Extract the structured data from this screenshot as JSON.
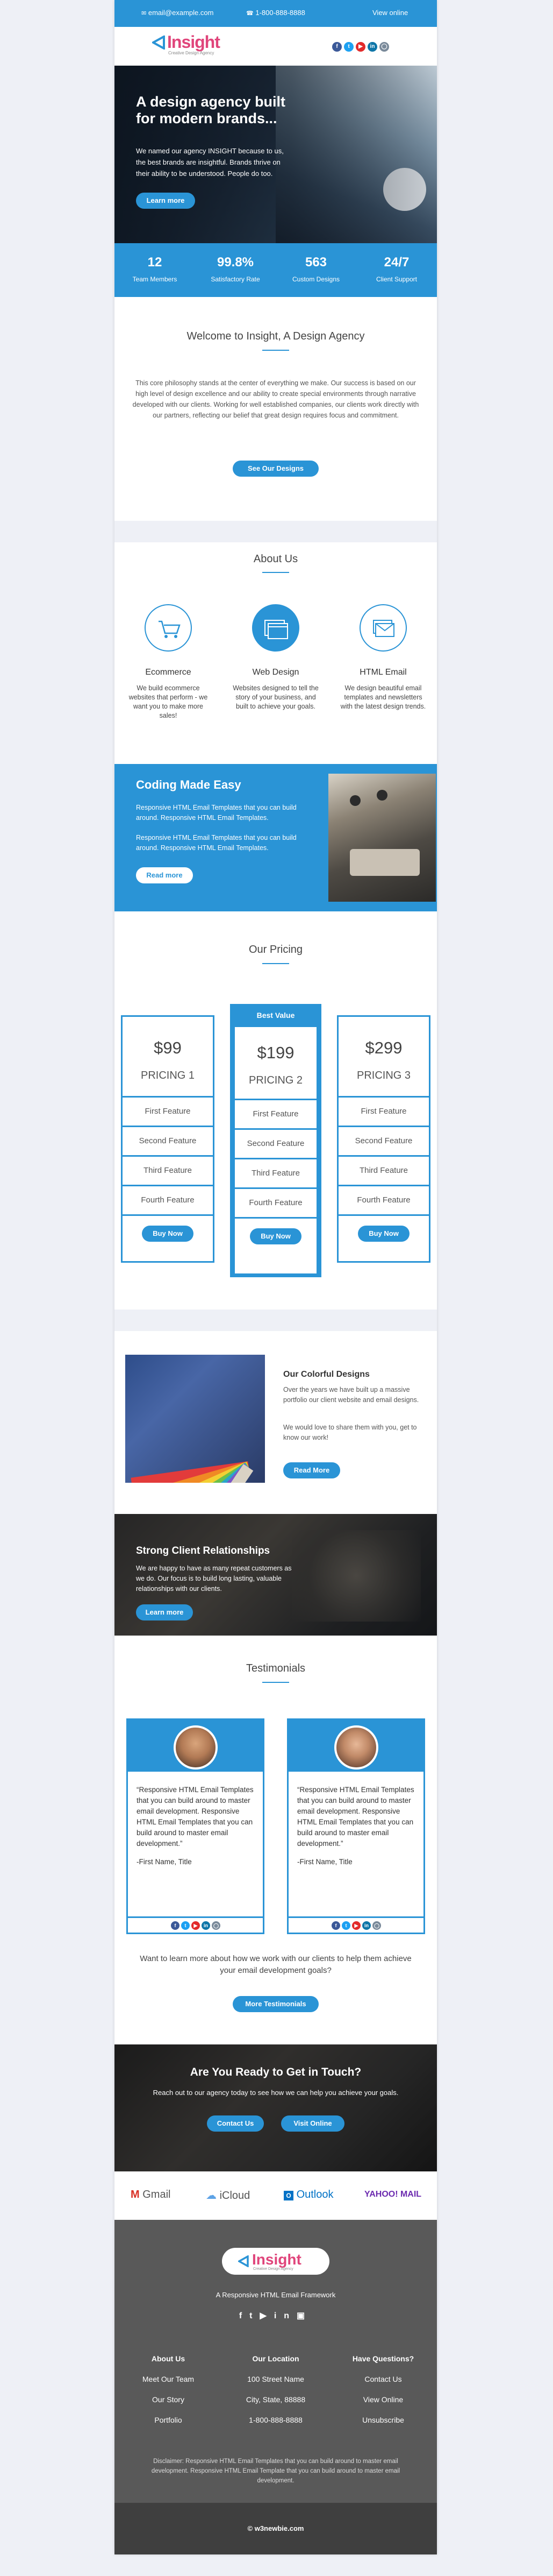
{
  "topbar": {
    "email": "email@example.com",
    "phone": "1-800-888-8888",
    "view_online": "View online"
  },
  "header": {
    "logo_text": "Insight",
    "logo_tagline": "Creative Design Agency",
    "social": [
      "f",
      "t",
      "y",
      "in",
      "ig"
    ]
  },
  "hero": {
    "title": "A design agency built for modern brands...",
    "body": "We named our agency INSIGHT because to us, the best brands are insightful. Brands thrive on their ability to be understood. People do too.",
    "cta": "Learn more"
  },
  "stats": [
    {
      "value": "12",
      "label": "Team Members"
    },
    {
      "value": "99.8%",
      "label": "Satisfactory Rate"
    },
    {
      "value": "563",
      "label": "Custom Designs"
    },
    {
      "value": "24/7",
      "label": "Client Support"
    }
  ],
  "welcome": {
    "title": "Welcome to Insight, A Design Agency",
    "body": "This core philosophy stands at the center of everything we make. Our success is based on our high level of design excellence and our ability to create special environments through narrative developed with our clients. Working for well established companies, our clients work directly with our partners, reflecting our belief that great design requires focus and commitment.",
    "cta": "See Our Designs"
  },
  "about": {
    "title": "About Us",
    "services": [
      {
        "title": "Ecommerce",
        "body": "We build ecommerce websites that perform - we want you to make more sales!"
      },
      {
        "title": "Web Design",
        "body": "Websites designed to tell the story of your business, and built to achieve your goals."
      },
      {
        "title": "HTML Email",
        "body": "We design beautiful email templates and newsletters with the latest design trends."
      }
    ]
  },
  "coding": {
    "title": "Coding Made Easy",
    "p1": "Responsive HTML Email Templates that you can build around. Responsive HTML Email Templates.",
    "p2": "Responsive HTML Email Templates that you can build around. Responsive HTML Email Templates.",
    "cta": "Read more"
  },
  "pricing": {
    "title": "Our Pricing",
    "badge": "Best Value",
    "plans": [
      {
        "price": "$99",
        "name": "PRICING 1",
        "features": [
          "First Feature",
          "Second Feature",
          "Third Feature",
          "Fourth Feature"
        ],
        "cta": "Buy Now"
      },
      {
        "price": "$199",
        "name": "PRICING 2",
        "features": [
          "First Feature",
          "Second Feature",
          "Third Feature",
          "Fourth Feature"
        ],
        "cta": "Buy Now"
      },
      {
        "price": "$299",
        "name": "PRICING 3",
        "features": [
          "First Feature",
          "Second Feature",
          "Third Feature",
          "Fourth Feature"
        ],
        "cta": "Buy Now"
      }
    ]
  },
  "designs": {
    "title": "Our Colorful Designs",
    "p1": "Over the years we have built up a massive portfolio our client website and email designs.",
    "p2": "We would love to share them with you, get to know our work!",
    "cta": "Read More"
  },
  "client": {
    "title": "Strong Client Relationships",
    "body": "We are happy to have as many repeat customers as we do. Our focus is to build long lasting, valuable relationships with our clients.",
    "cta": "Learn more"
  },
  "testimonials": {
    "title": "Testimonials",
    "items": [
      {
        "quote": "“Responsive HTML Email Templates that you can build around to master email development. Responsive HTML Email Templates that you can build around to master email development.”",
        "name": "-First Name, Title"
      },
      {
        "quote": "“Responsive HTML Email Templates that you can build around to master email development. Responsive HTML Email Templates that you can build around to master email development.”",
        "name": "-First Name, Title"
      }
    ],
    "more_text": "Want to learn more about how we work with our clients to help them achieve your email development goals?",
    "cta": "More Testimonials"
  },
  "ready": {
    "title": "Are You Ready to Get in Touch?",
    "body": "Reach out to our agency today to see how we can help you achieve your goals.",
    "contact": "Contact Us",
    "visit": "Visit Online"
  },
  "email_clients": [
    "Gmail",
    "iCloud",
    "Outlook",
    "YAHOO! MAIL"
  ],
  "footer": {
    "tagline": "A Responsive HTML Email Framework",
    "col1": [
      "About Us",
      "Meet Our Team",
      "Our Story",
      "Portfolio"
    ],
    "col2_title": "Our Location",
    "col2": [
      "100 Street Name",
      "City, State, 88888",
      "1-800-888-8888"
    ],
    "col3_title": "Have Questions?",
    "col3": [
      "Contact Us",
      "View Online",
      "Unsubscribe"
    ],
    "disclaimer": "Disclaimer: Responsive HTML Email Templates that you can build around to master email development. Responsive HTML Email Template that you can build around to master email development.",
    "copyright": "© w3newbie.com"
  },
  "colors": {
    "accent": "#2a94d6",
    "footer": "#595959",
    "copyright": "#3f3f3f",
    "page_bg": "#eef0f6"
  }
}
